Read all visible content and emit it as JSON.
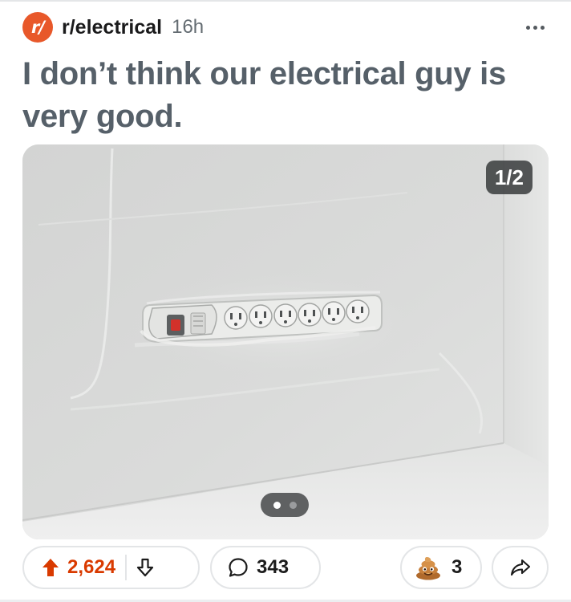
{
  "post": {
    "subreddit": "r/electrical",
    "subreddit_icon_letter": "r/",
    "age": "16h",
    "title": "I don’t think our electrical guy is very good."
  },
  "media": {
    "counter": "1/2",
    "image_count": 2,
    "current_index": 1,
    "description_icon": "power-strip-photo"
  },
  "actions": {
    "score": "2,624",
    "comments": "343",
    "awards": "3"
  },
  "icons": {
    "subreddit": "reddit-sub-icon",
    "more": "more-dots-icon",
    "upvote": "upvote-arrow-icon",
    "downvote": "downvote-arrow-icon",
    "comment": "comment-bubble-icon",
    "award": "poop-award-icon",
    "share": "share-arrow-icon"
  },
  "colors": {
    "brand": "#e8582a",
    "upvote_active": "#d93a00",
    "title": "#566069",
    "meta": "#646c72",
    "pill_border": "#e3e5e7"
  }
}
